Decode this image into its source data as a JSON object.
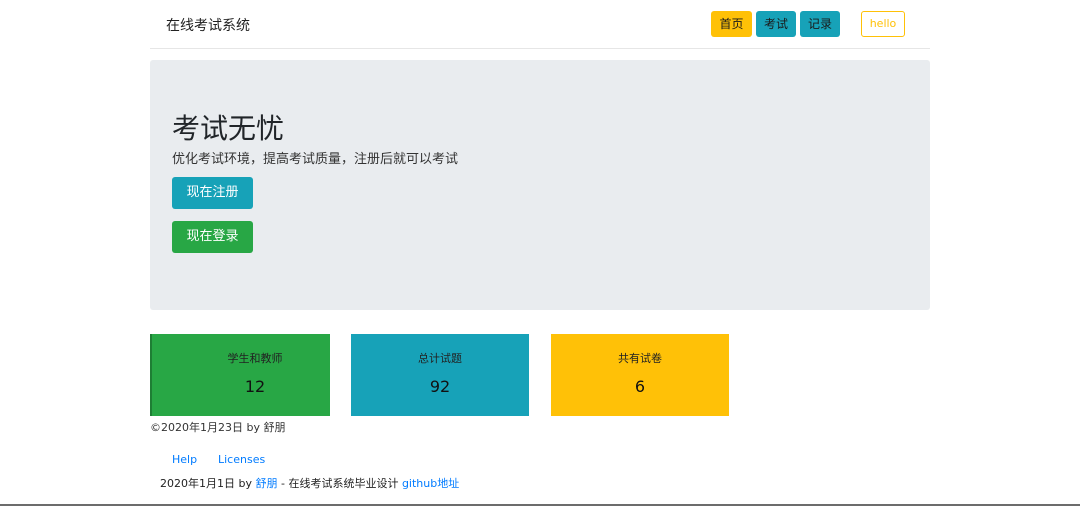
{
  "navbar": {
    "brand": "在线考试系统",
    "home_label": "首页",
    "exam_label": "考试",
    "record_label": "记录",
    "user_label": "hello"
  },
  "jumbotron": {
    "title": "考试无忧",
    "lead": "优化考试环境，提高考试质量，注册后就可以考试",
    "register_label": "现在注册",
    "login_label": "现在登录"
  },
  "stats": {
    "users_label": "学生和教师",
    "users_value": "12",
    "questions_label": "总计试题",
    "questions_value": "92",
    "papers_label": "共有试卷",
    "papers_value": "6"
  },
  "copyright": "©2020年1月23日 by 舒朋",
  "footer": {
    "help_label": "Help",
    "licenses_label": "Licenses",
    "date_by": "2020年1月1日 by ",
    "author": "舒朋",
    "middle": " - 在线考试系统毕业设计 ",
    "github_label": "github地址"
  },
  "colors": {
    "primary_warning": "#ffc107",
    "info": "#17a2b8",
    "success": "#28a745",
    "jumbotron_bg": "#e9ecef",
    "link": "#007bff"
  }
}
